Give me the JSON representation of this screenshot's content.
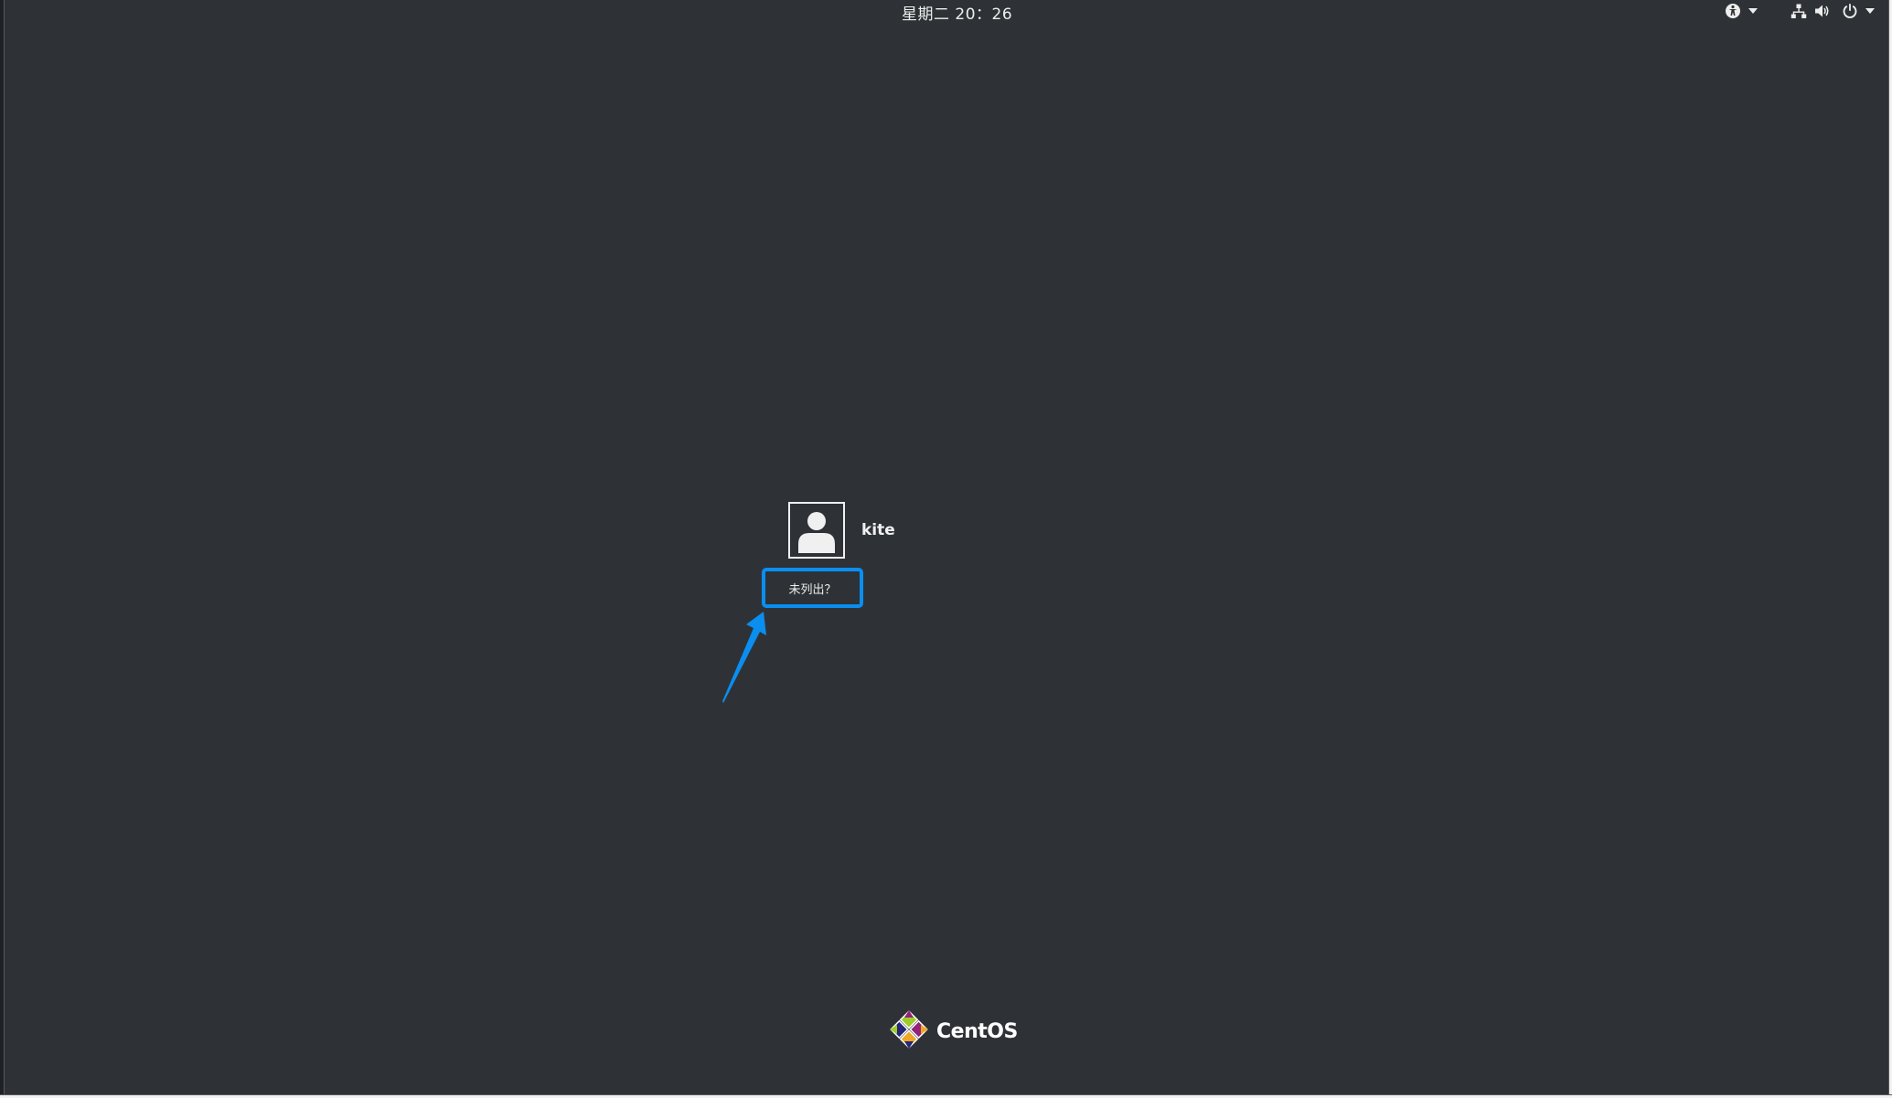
{
  "top_bar": {
    "clock": "星期二 20：26",
    "icons": {
      "accessibility": "accessibility-icon",
      "network": "network-wired-icon",
      "volume": "volume-icon",
      "power": "power-icon"
    }
  },
  "users": [
    {
      "name": "kite",
      "avatar_icon": "user-avatar-icon"
    }
  ],
  "not_listed": {
    "label": "未列出？",
    "highlight_color": "#0a8ef0"
  },
  "branding": {
    "logo_icon": "centos-logo-icon",
    "text": "CentOS"
  },
  "colors": {
    "background": "#2e3236",
    "text": "#eeeeec",
    "annotation": "#0a8ef0"
  }
}
